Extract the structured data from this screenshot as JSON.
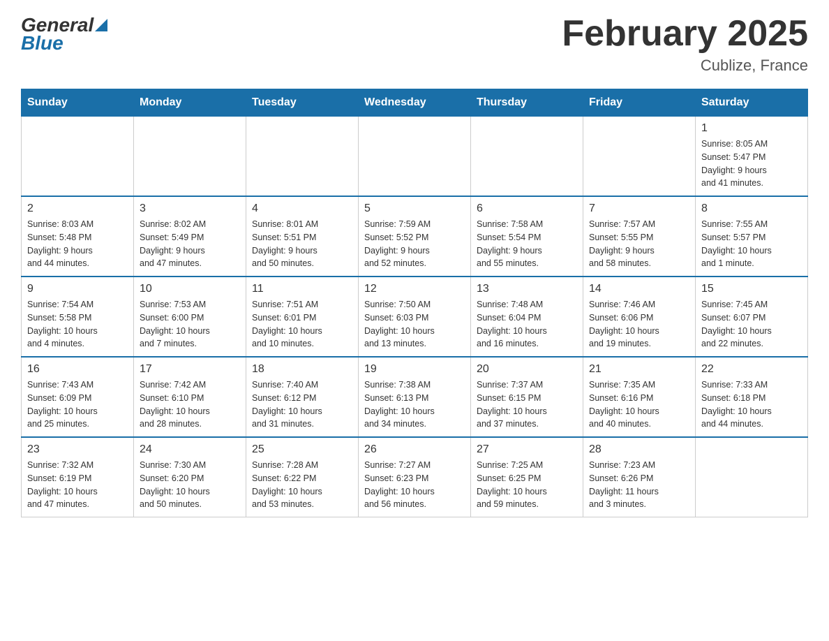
{
  "header": {
    "logo_line1": "General",
    "logo_line2": "Blue",
    "title": "February 2025",
    "subtitle": "Cublize, France"
  },
  "days_of_week": [
    "Sunday",
    "Monday",
    "Tuesday",
    "Wednesday",
    "Thursday",
    "Friday",
    "Saturday"
  ],
  "weeks": [
    [
      {
        "day": "",
        "info": ""
      },
      {
        "day": "",
        "info": ""
      },
      {
        "day": "",
        "info": ""
      },
      {
        "day": "",
        "info": ""
      },
      {
        "day": "",
        "info": ""
      },
      {
        "day": "",
        "info": ""
      },
      {
        "day": "1",
        "info": "Sunrise: 8:05 AM\nSunset: 5:47 PM\nDaylight: 9 hours\nand 41 minutes."
      }
    ],
    [
      {
        "day": "2",
        "info": "Sunrise: 8:03 AM\nSunset: 5:48 PM\nDaylight: 9 hours\nand 44 minutes."
      },
      {
        "day": "3",
        "info": "Sunrise: 8:02 AM\nSunset: 5:49 PM\nDaylight: 9 hours\nand 47 minutes."
      },
      {
        "day": "4",
        "info": "Sunrise: 8:01 AM\nSunset: 5:51 PM\nDaylight: 9 hours\nand 50 minutes."
      },
      {
        "day": "5",
        "info": "Sunrise: 7:59 AM\nSunset: 5:52 PM\nDaylight: 9 hours\nand 52 minutes."
      },
      {
        "day": "6",
        "info": "Sunrise: 7:58 AM\nSunset: 5:54 PM\nDaylight: 9 hours\nand 55 minutes."
      },
      {
        "day": "7",
        "info": "Sunrise: 7:57 AM\nSunset: 5:55 PM\nDaylight: 9 hours\nand 58 minutes."
      },
      {
        "day": "8",
        "info": "Sunrise: 7:55 AM\nSunset: 5:57 PM\nDaylight: 10 hours\nand 1 minute."
      }
    ],
    [
      {
        "day": "9",
        "info": "Sunrise: 7:54 AM\nSunset: 5:58 PM\nDaylight: 10 hours\nand 4 minutes."
      },
      {
        "day": "10",
        "info": "Sunrise: 7:53 AM\nSunset: 6:00 PM\nDaylight: 10 hours\nand 7 minutes."
      },
      {
        "day": "11",
        "info": "Sunrise: 7:51 AM\nSunset: 6:01 PM\nDaylight: 10 hours\nand 10 minutes."
      },
      {
        "day": "12",
        "info": "Sunrise: 7:50 AM\nSunset: 6:03 PM\nDaylight: 10 hours\nand 13 minutes."
      },
      {
        "day": "13",
        "info": "Sunrise: 7:48 AM\nSunset: 6:04 PM\nDaylight: 10 hours\nand 16 minutes."
      },
      {
        "day": "14",
        "info": "Sunrise: 7:46 AM\nSunset: 6:06 PM\nDaylight: 10 hours\nand 19 minutes."
      },
      {
        "day": "15",
        "info": "Sunrise: 7:45 AM\nSunset: 6:07 PM\nDaylight: 10 hours\nand 22 minutes."
      }
    ],
    [
      {
        "day": "16",
        "info": "Sunrise: 7:43 AM\nSunset: 6:09 PM\nDaylight: 10 hours\nand 25 minutes."
      },
      {
        "day": "17",
        "info": "Sunrise: 7:42 AM\nSunset: 6:10 PM\nDaylight: 10 hours\nand 28 minutes."
      },
      {
        "day": "18",
        "info": "Sunrise: 7:40 AM\nSunset: 6:12 PM\nDaylight: 10 hours\nand 31 minutes."
      },
      {
        "day": "19",
        "info": "Sunrise: 7:38 AM\nSunset: 6:13 PM\nDaylight: 10 hours\nand 34 minutes."
      },
      {
        "day": "20",
        "info": "Sunrise: 7:37 AM\nSunset: 6:15 PM\nDaylight: 10 hours\nand 37 minutes."
      },
      {
        "day": "21",
        "info": "Sunrise: 7:35 AM\nSunset: 6:16 PM\nDaylight: 10 hours\nand 40 minutes."
      },
      {
        "day": "22",
        "info": "Sunrise: 7:33 AM\nSunset: 6:18 PM\nDaylight: 10 hours\nand 44 minutes."
      }
    ],
    [
      {
        "day": "23",
        "info": "Sunrise: 7:32 AM\nSunset: 6:19 PM\nDaylight: 10 hours\nand 47 minutes."
      },
      {
        "day": "24",
        "info": "Sunrise: 7:30 AM\nSunset: 6:20 PM\nDaylight: 10 hours\nand 50 minutes."
      },
      {
        "day": "25",
        "info": "Sunrise: 7:28 AM\nSunset: 6:22 PM\nDaylight: 10 hours\nand 53 minutes."
      },
      {
        "day": "26",
        "info": "Sunrise: 7:27 AM\nSunset: 6:23 PM\nDaylight: 10 hours\nand 56 minutes."
      },
      {
        "day": "27",
        "info": "Sunrise: 7:25 AM\nSunset: 6:25 PM\nDaylight: 10 hours\nand 59 minutes."
      },
      {
        "day": "28",
        "info": "Sunrise: 7:23 AM\nSunset: 6:26 PM\nDaylight: 11 hours\nand 3 minutes."
      },
      {
        "day": "",
        "info": ""
      }
    ]
  ]
}
